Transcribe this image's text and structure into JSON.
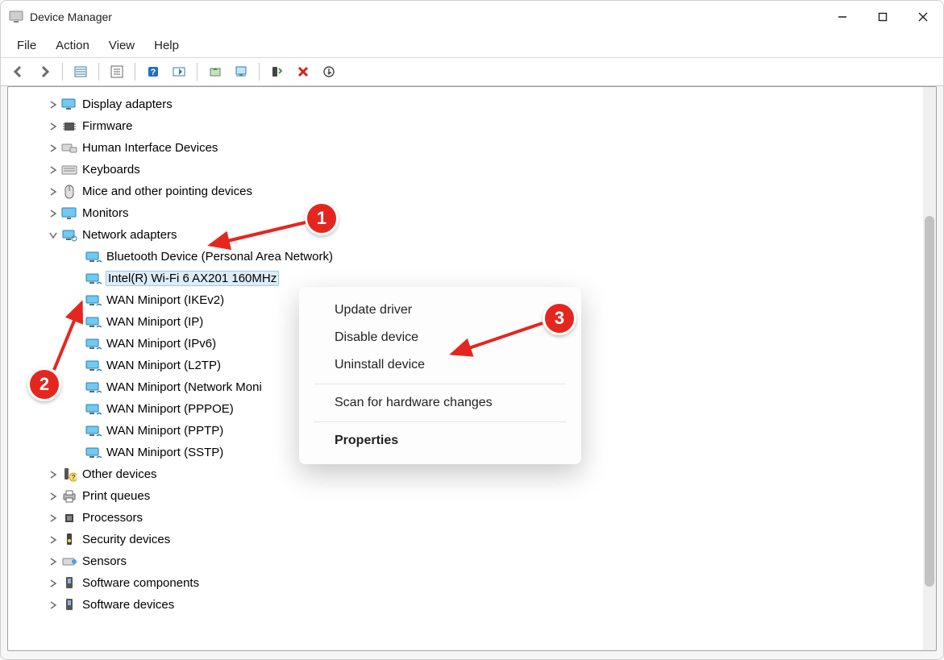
{
  "window": {
    "title": "Device Manager"
  },
  "menubar": [
    "File",
    "Action",
    "View",
    "Help"
  ],
  "tree": {
    "categories": [
      {
        "label": "Display adapters",
        "icon": "monitor",
        "expanded": false,
        "children": []
      },
      {
        "label": "Firmware",
        "icon": "chip",
        "expanded": false,
        "children": []
      },
      {
        "label": "Human Interface Devices",
        "icon": "hid",
        "expanded": false,
        "children": []
      },
      {
        "label": "Keyboards",
        "icon": "keyboard",
        "expanded": false,
        "children": []
      },
      {
        "label": "Mice and other pointing devices",
        "icon": "mouse",
        "expanded": false,
        "children": []
      },
      {
        "label": "Monitors",
        "icon": "display",
        "expanded": false,
        "children": []
      },
      {
        "label": "Network adapters",
        "icon": "network",
        "expanded": true,
        "children": [
          {
            "label": "Bluetooth Device (Personal Area Network)",
            "icon": "net",
            "selected": false
          },
          {
            "label": "Intel(R) Wi-Fi 6 AX201 160MHz",
            "icon": "net",
            "selected": true
          },
          {
            "label": "WAN Miniport (IKEv2)",
            "icon": "net",
            "selected": false
          },
          {
            "label": "WAN Miniport (IP)",
            "icon": "net",
            "selected": false
          },
          {
            "label": "WAN Miniport (IPv6)",
            "icon": "net",
            "selected": false
          },
          {
            "label": "WAN Miniport (L2TP)",
            "icon": "net",
            "selected": false
          },
          {
            "label": "WAN Miniport (Network Moni",
            "icon": "net",
            "selected": false
          },
          {
            "label": "WAN Miniport (PPPOE)",
            "icon": "net",
            "selected": false
          },
          {
            "label": "WAN Miniport (PPTP)",
            "icon": "net",
            "selected": false
          },
          {
            "label": "WAN Miniport (SSTP)",
            "icon": "net",
            "selected": false
          }
        ]
      },
      {
        "label": "Other devices",
        "icon": "other",
        "expanded": false,
        "children": []
      },
      {
        "label": "Print queues",
        "icon": "printer",
        "expanded": false,
        "children": []
      },
      {
        "label": "Processors",
        "icon": "cpu",
        "expanded": false,
        "children": []
      },
      {
        "label": "Security devices",
        "icon": "security",
        "expanded": false,
        "children": []
      },
      {
        "label": "Sensors",
        "icon": "sensor",
        "expanded": false,
        "children": []
      },
      {
        "label": "Software components",
        "icon": "sw",
        "expanded": false,
        "children": []
      },
      {
        "label": "Software devices",
        "icon": "sw",
        "expanded": false,
        "children": []
      }
    ]
  },
  "contextMenu": {
    "items": [
      {
        "label": "Update driver",
        "type": "item"
      },
      {
        "label": "Disable device",
        "type": "item"
      },
      {
        "label": "Uninstall device",
        "type": "item"
      },
      {
        "type": "sep"
      },
      {
        "label": "Scan for hardware changes",
        "type": "item"
      },
      {
        "type": "sep"
      },
      {
        "label": "Properties",
        "type": "bold"
      }
    ]
  },
  "annotations": {
    "badges": [
      "1",
      "2",
      "3"
    ]
  }
}
